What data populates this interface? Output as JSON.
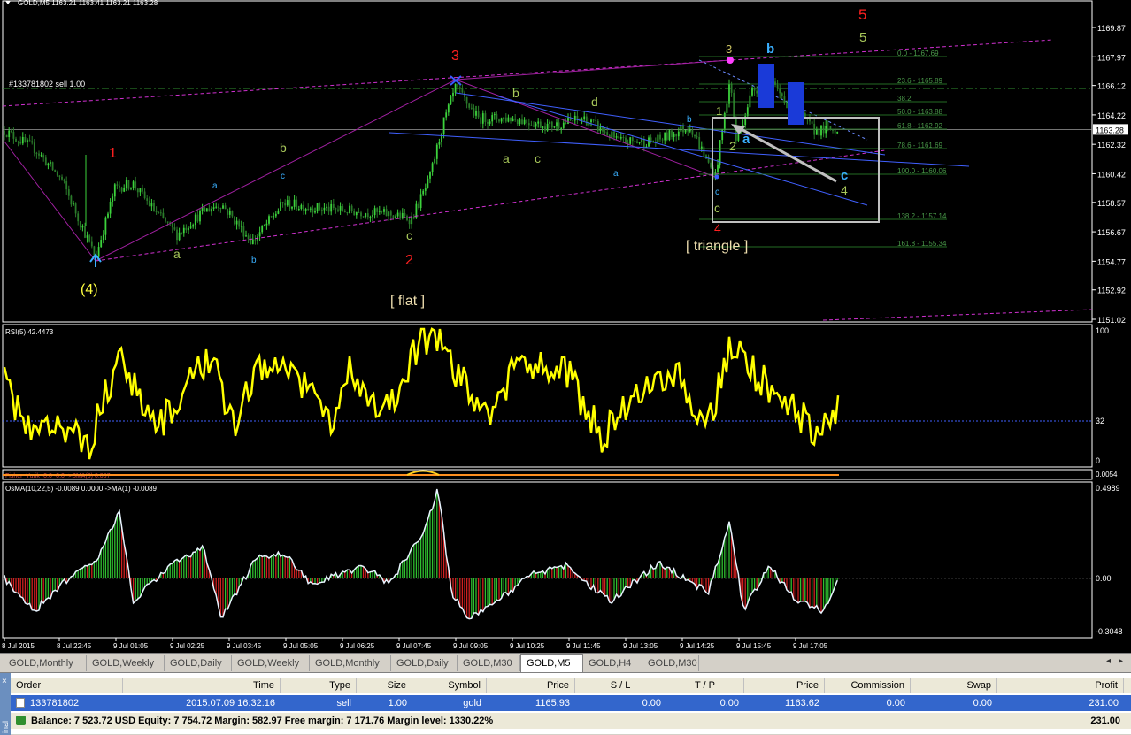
{
  "window": {
    "chart_title": "GOLD,M5  1163.21 1163.41 1163.21 1163.28",
    "order_label": "#133781802 sell 1.00"
  },
  "price_axis": {
    "labels": [
      "1169.87",
      "1167.97",
      "1166.12",
      "1164.22",
      "1162.32",
      "1160.42",
      "1158.57",
      "1156.67",
      "1154.77",
      "1152.92",
      "1151.02"
    ],
    "current_price": "1163.28"
  },
  "fib_levels": [
    "0.0 - 1167.69",
    "23.6 - 1165.89",
    "38.2",
    "50.0 - 1163.88",
    "61.8 - 1162.92",
    "78.6 - 1161.69",
    "100.0 - 1160.06",
    "138.2 - 1157.14",
    "161.8 - 1155.34"
  ],
  "wave_labels": {
    "w1": "1",
    "w2": "2",
    "w3": "3",
    "w4": "(4)",
    "w5": "5",
    "a": "a",
    "b": "b",
    "c": "c",
    "d": "d",
    "flat": "[ flat ]",
    "triangle": "[ triangle ]",
    "g2": "2",
    "g3": "3",
    "g4": "4",
    "g5": "5",
    "g1": "1",
    "r4": "4",
    "blue_a": "a",
    "blue_b": "b",
    "blue_c": "c"
  },
  "rsi": {
    "title": "RSI(5) 42.4473",
    "level_100": "100",
    "level_32": "32",
    "level_0": "0"
  },
  "fisher": {
    "title": "Fisher_Yurik  -0.0 -0.0  ->SMA(3) 0.037",
    "level": "0.0054"
  },
  "osma": {
    "title": "OsMA(10,22,5) -0.0089 0.0000  ->MA(1) -0.0089",
    "top": "0.4989",
    "zero": "0.00",
    "bottom": "-0.3048"
  },
  "time_axis": [
    "8 Jul 2015",
    "8 Jul 22:45",
    "9 Jul 01:05",
    "9 Jul 02:25",
    "9 Jul 03:45",
    "9 Jul 05:05",
    "9 Jul 06:25",
    "9 Jul 07:45",
    "9 Jul 09:05",
    "9 Jul 10:25",
    "9 Jul 11:45",
    "9 Jul 13:05",
    "9 Jul 14:25",
    "9 Jul 15:45",
    "9 Jul 17:05"
  ],
  "tabs": [
    "GOLD,Monthly",
    "GOLD,Weekly",
    "GOLD,Daily",
    "GOLD,Weekly",
    "GOLD,Monthly",
    "GOLD,Daily",
    "GOLD,M30",
    "GOLD,M5",
    "GOLD,H4",
    "GOLD,M30"
  ],
  "active_tab": "GOLD,M5",
  "terminal": {
    "side_label": "inal",
    "columns": [
      "Order",
      "Time",
      "Type",
      "Size",
      "Symbol",
      "Price",
      "S / L",
      "T / P",
      "Price",
      "Commission",
      "Swap",
      "Profit"
    ],
    "row": [
      "133781802",
      "2015.07.09 16:32:16",
      "sell",
      "1.00",
      "gold",
      "1165.93",
      "0.00",
      "0.00",
      "1163.62",
      "0.00",
      "0.00",
      "231.00"
    ],
    "balance": "Balance: 7 523.72 USD  Equity: 7 754.72  Margin: 582.97  Free margin: 7 171.76  Margin level: 1330.22%",
    "balance_profit": "231.00"
  },
  "colors": {
    "bull": "#3cd23c",
    "bear": "#2a7a2a",
    "rsi": "#ffff00",
    "wave_red": "#ff2020",
    "wave_yellow": "#ffff40",
    "wave_green": "#a8c85a",
    "wave_cyan": "#3ab0ff",
    "trend_magenta": "#d030d0",
    "channel_blue": "#4060ff",
    "fib": "#2f8f2f"
  }
}
